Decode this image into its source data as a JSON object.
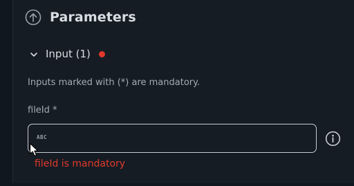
{
  "header": {
    "title": "Parameters",
    "icon": "circle-arrow-up-icon"
  },
  "section": {
    "label": "Input (1)",
    "expanded": true,
    "status_color": "#e0392b"
  },
  "hint": "Inputs marked with (*) are mandatory.",
  "field": {
    "label": "fileId *",
    "value": "",
    "type_icon_text": "ABC",
    "error": "fileId is mandatory"
  },
  "colors": {
    "background": "#161c24",
    "text": "#d9dde3",
    "muted": "#a4abb4",
    "error": "#e0392b",
    "border": "#c7ccd3"
  }
}
